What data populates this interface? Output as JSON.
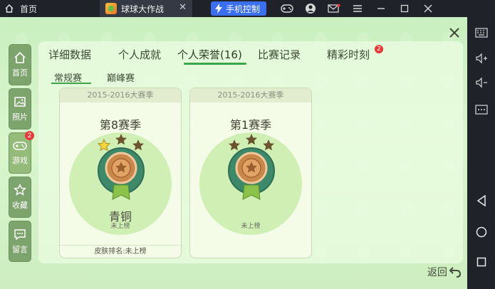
{
  "titlebar": {
    "home_label": "首页",
    "tab_title": "球球大作战",
    "tab_close": "✕",
    "phone_control": "手机控制"
  },
  "nav": [
    {
      "label": "首页",
      "icon": "home-icon"
    },
    {
      "label": "照片",
      "icon": "photo-icon"
    },
    {
      "label": "游戏",
      "icon": "gamepad-icon",
      "badge": "2"
    },
    {
      "label": "收藏",
      "icon": "star-icon"
    },
    {
      "label": "留言",
      "icon": "chat-icon"
    }
  ],
  "tabs": [
    {
      "label": "详细数据"
    },
    {
      "label": "个人成就"
    },
    {
      "label": "个人荣誉(16)"
    },
    {
      "label": "比赛记录"
    },
    {
      "label": "精彩时刻",
      "badge": "2"
    }
  ],
  "subtabs": [
    "常规赛",
    "巅峰赛"
  ],
  "cards": [
    {
      "header": "2015-2016大赛季",
      "season": "第8赛季",
      "stars_lit": 1,
      "stars_total": 3,
      "rank": "青铜",
      "status": "未上榜",
      "skin": "皮肤排名:未上榜"
    },
    {
      "header": "2015-2016大赛季",
      "season": "第1赛季",
      "stars_lit": 0,
      "stars_total": 3,
      "rank": "",
      "status": "未上榜",
      "skin": ""
    }
  ],
  "back_label": "返回",
  "colors": {
    "accent": "#3aa64a",
    "badge": "#e83a3a",
    "nav": "#7ea46e",
    "medal": "#c9874a"
  }
}
